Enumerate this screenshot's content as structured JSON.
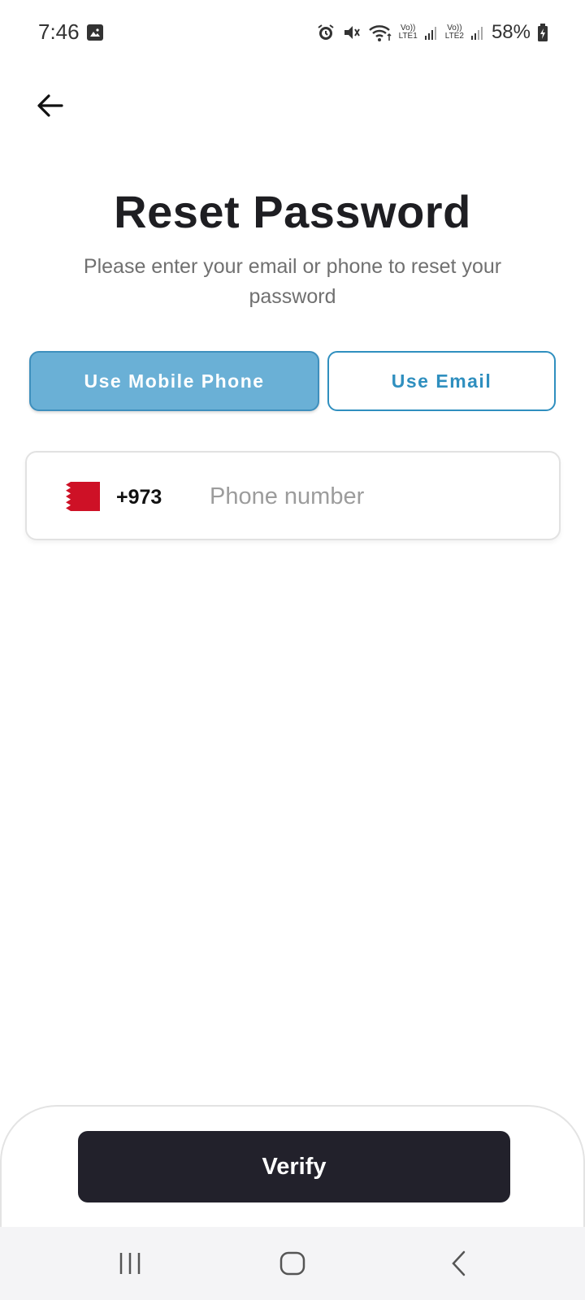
{
  "status_bar": {
    "time": "7:46",
    "lte1": "LTE1",
    "lte2": "LTE2",
    "volte1": "Vo))",
    "volte2": "Vo))",
    "battery": "58%",
    "icons": [
      "gallery-icon",
      "alarm-icon",
      "mute-icon",
      "wifi-icon",
      "signal-icon",
      "battery-icon"
    ]
  },
  "header": {
    "title": "Reset Password",
    "subtitle": "Please enter your email or phone to reset your password"
  },
  "method_toggle": {
    "phone_label": "Use Mobile Phone",
    "email_label": "Use Email",
    "selected": "phone"
  },
  "phone_field": {
    "dial_code": "+973",
    "country_flag": "bahrain-flag",
    "value": "",
    "placeholder": "Phone number"
  },
  "footer": {
    "verify_label": "Verify"
  },
  "colors": {
    "accent": "#6ab0d6",
    "accent_border": "#2f8fbf",
    "primary_dark": "#22212b",
    "flag_red": "#ce1126"
  }
}
